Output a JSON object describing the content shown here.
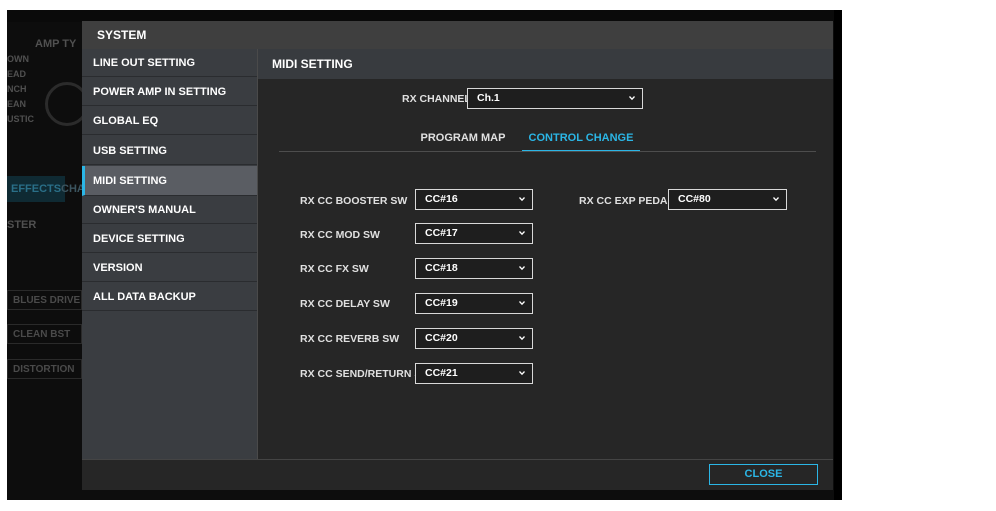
{
  "background": {
    "amp_type": "AMP TY",
    "amp_list": [
      "OWN",
      "EAD",
      "NCH",
      "EAN",
      "USTIC"
    ],
    "tab_effects": "EFFECTS",
    "tab_cha": "CHA",
    "label_ster": "STER",
    "buttons": [
      "BLUES DRIVE",
      "CLEAN BST",
      "DISTORTION"
    ]
  },
  "modal": {
    "title": "SYSTEM",
    "close_label": "CLOSE",
    "accent_color": "#2bb6e6"
  },
  "sidebar": {
    "items": [
      {
        "label": "LINE OUT SETTING"
      },
      {
        "label": "POWER AMP IN SETTING"
      },
      {
        "label": "GLOBAL EQ"
      },
      {
        "label": "USB SETTING"
      },
      {
        "label": "MIDI SETTING",
        "active": true
      },
      {
        "label": "OWNER'S MANUAL"
      },
      {
        "label": "DEVICE SETTING"
      },
      {
        "label": "VERSION"
      },
      {
        "label": "ALL DATA BACKUP"
      }
    ]
  },
  "content": {
    "title": "MIDI SETTING",
    "rx_channel_label": "RX CHANNEL",
    "rx_channel_value": "Ch.1",
    "tabs": [
      {
        "label": "PROGRAM MAP"
      },
      {
        "label": "CONTROL CHANGE",
        "active": true
      }
    ],
    "fields": [
      {
        "label": "RX CC BOOSTER SW",
        "value": "CC#16"
      },
      {
        "label": "RX CC MOD SW",
        "value": "CC#17"
      },
      {
        "label": "RX CC FX SW",
        "value": "CC#18"
      },
      {
        "label": "RX CC DELAY SW",
        "value": "CC#19"
      },
      {
        "label": "RX CC REVERB SW",
        "value": "CC#20"
      },
      {
        "label": "RX CC SEND/RETURN SW",
        "value": "CC#21"
      }
    ],
    "exp_pedal": {
      "label": "RX CC EXP PEDAL",
      "value": "CC#80"
    }
  }
}
